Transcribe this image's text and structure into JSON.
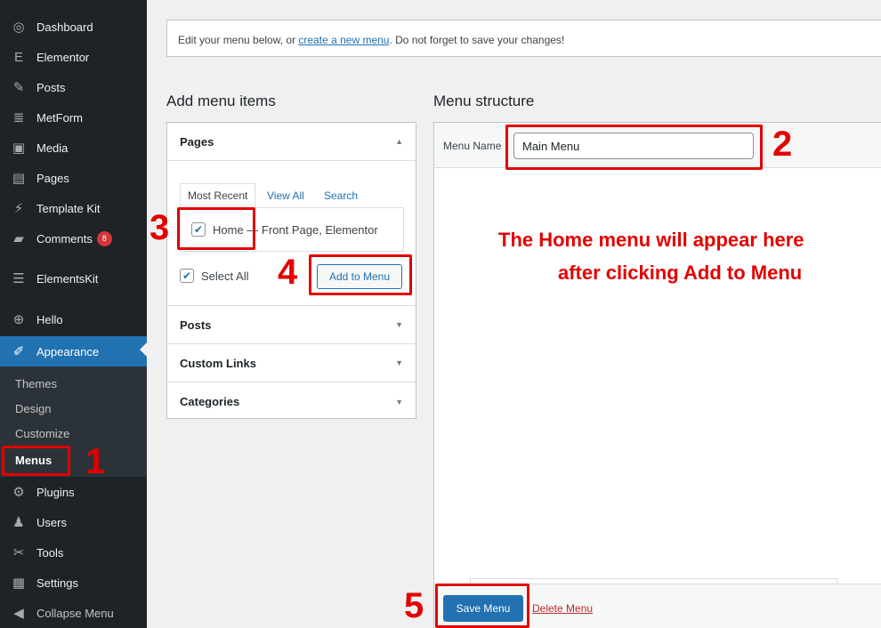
{
  "sidebar": {
    "items": [
      {
        "label": "Dashboard",
        "icon": "dashboard-icon",
        "glyph": "◎"
      },
      {
        "label": "Elementor",
        "icon": "elementor-icon",
        "glyph": "E"
      },
      {
        "label": "Posts",
        "icon": "pin-icon",
        "glyph": "✎"
      },
      {
        "label": "MetForm",
        "icon": "form-icon",
        "glyph": "≣"
      },
      {
        "label": "Media",
        "icon": "media-icon",
        "glyph": "▣"
      },
      {
        "label": "Pages",
        "icon": "page-icon",
        "glyph": "▤"
      },
      {
        "label": "Template Kit",
        "icon": "template-icon",
        "glyph": "⚡"
      },
      {
        "label": "Comments",
        "icon": "comment-icon",
        "glyph": "▰",
        "badge": "8"
      },
      {
        "label": "ElementsKit",
        "icon": "elementskit-icon",
        "glyph": "☰"
      },
      {
        "label": "Hello",
        "icon": "plus-circle-icon",
        "glyph": "⊕"
      },
      {
        "label": "Appearance",
        "icon": "brush-icon",
        "glyph": "✐"
      },
      {
        "label": "Plugins",
        "icon": "plug-icon",
        "glyph": "⚙"
      },
      {
        "label": "Users",
        "icon": "user-icon",
        "glyph": "♟"
      },
      {
        "label": "Tools",
        "icon": "wrench-icon",
        "glyph": "✂"
      },
      {
        "label": "Settings",
        "icon": "settings-icon",
        "glyph": "▦"
      },
      {
        "label": "Collapse Menu",
        "icon": "collapse-icon",
        "glyph": "◀"
      }
    ],
    "submenu": [
      "Themes",
      "Design",
      "Customize",
      "Menus"
    ]
  },
  "notice": {
    "before": "Edit your menu below, or ",
    "link": "create a new menu",
    "after": ". Do not forget to save your changes!"
  },
  "add_items": {
    "title": "Add menu items",
    "pages_label": "Pages",
    "tabs": [
      "Most Recent",
      "View All",
      "Search"
    ],
    "page_item": "Home — Front Page, Elementor",
    "select_all": "Select All",
    "add_button": "Add to Menu",
    "sections": [
      "Posts",
      "Custom Links",
      "Categories"
    ]
  },
  "structure": {
    "title": "Menu structure",
    "menu_name_label": "Menu Name",
    "menu_name_value": "Main Menu",
    "save_button": "Save Menu",
    "delete_link": "Delete Menu"
  },
  "annotations": {
    "steps": [
      "1",
      "2",
      "3",
      "4",
      "5"
    ],
    "note_line1": "The Home menu will appear here",
    "note_line2": "after clicking  Add to Menu"
  }
}
